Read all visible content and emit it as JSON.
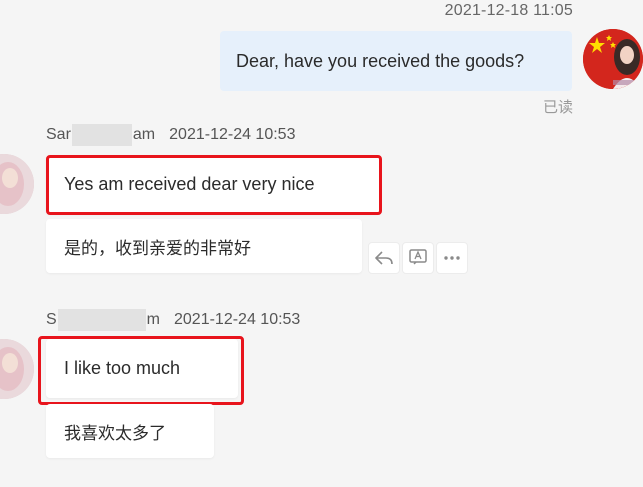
{
  "outgoing": {
    "timestamp": "2021-12-18 11:05",
    "text": "Dear, have you received the goods?",
    "status": "已读"
  },
  "messages": [
    {
      "sender_prefix": "Sar",
      "sender_suffix": "am",
      "timestamp": "2021-12-24 10:53",
      "text_en": "Yes am received dear very nice",
      "text_zh": "是的，收到亲爱的非常好"
    },
    {
      "sender_prefix": "S",
      "sender_suffix": "m",
      "timestamp": "2021-12-24 10:53",
      "text_en": "I like too much",
      "text_zh": "我喜欢太多了"
    }
  ],
  "icons": {
    "reply": "reply-icon",
    "translate": "translate-icon",
    "more": "more-icon"
  },
  "colors": {
    "highlight": "#e8141c",
    "outgoing_bubble": "#e6f0fb",
    "incoming_bubble": "#ffffff"
  }
}
